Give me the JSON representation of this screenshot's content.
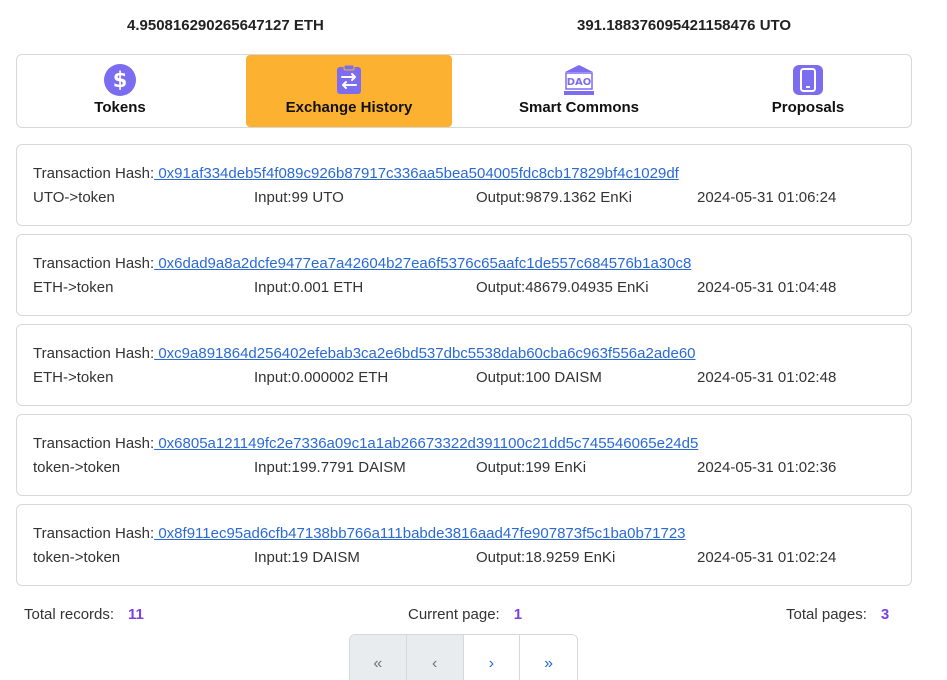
{
  "balances": {
    "eth": "4.950816290265647127 ETH",
    "uto": "391.188376095421158476 UTO"
  },
  "tabs": [
    {
      "label": "Tokens",
      "icon": "dollar-icon",
      "active": false
    },
    {
      "label": "Exchange History",
      "icon": "exchange-icon",
      "active": true
    },
    {
      "label": "Smart Commons",
      "icon": "dao-icon",
      "active": false
    },
    {
      "label": "Proposals",
      "icon": "phone-icon",
      "active": false
    }
  ],
  "colors": {
    "accent": "#fdb130",
    "icon_purple": "#7b6cf0",
    "link": "#2a6ad6",
    "count": "#7b3fe4"
  },
  "transactions": [
    {
      "hash_label": "Transaction Hash:",
      "hash": " 0x91af334deb5f4f089c926b87917c336aa5bea504005fdc8cb17829bf4c1029df",
      "type": "UTO->token",
      "input": "Input:99 UTO",
      "output": "Output:9879.1362 EnKi",
      "time": "2024-05-31 01:06:24"
    },
    {
      "hash_label": "Transaction Hash:",
      "hash": " 0x6dad9a8a2dcfe9477ea7a42604b27ea6f5376c65aafc1de557c684576b1a30c8",
      "type": "ETH->token",
      "input": "Input:0.001 ETH",
      "output": "Output:48679.04935 EnKi",
      "time": "2024-05-31 01:04:48"
    },
    {
      "hash_label": "Transaction Hash:",
      "hash": " 0xc9a891864d256402efebab3ca2e6bd537dbc5538dab60cba6c963f556a2ade60",
      "type": "ETH->token",
      "input": "Input:0.000002 ETH",
      "output": "Output:100 DAISM",
      "time": "2024-05-31 01:02:48"
    },
    {
      "hash_label": "Transaction Hash:",
      "hash": " 0x6805a121149fc2e7336a09c1a1ab26673322d391100c21dd5c745546065e24d5",
      "type": "token->token",
      "input": "Input:199.7791 DAISM",
      "output": "Output:199 EnKi",
      "time": "2024-05-31 01:02:36"
    },
    {
      "hash_label": "Transaction Hash:",
      "hash": " 0x8f911ec95ad6cfb47138bb766a111babde3816aad47fe907873f5c1ba0b71723",
      "type": "token->token",
      "input": "Input:19 DAISM",
      "output": "Output:18.9259 EnKi",
      "time": "2024-05-31 01:02:24"
    }
  ],
  "footer": {
    "total_records_label": "Total records:",
    "total_records": "11",
    "current_page_label": "Current page:",
    "current_page": "1",
    "total_pages_label": "Total pages:",
    "total_pages": "3"
  },
  "pager": {
    "first": "«",
    "prev": "‹",
    "next": "›",
    "last": "»"
  }
}
